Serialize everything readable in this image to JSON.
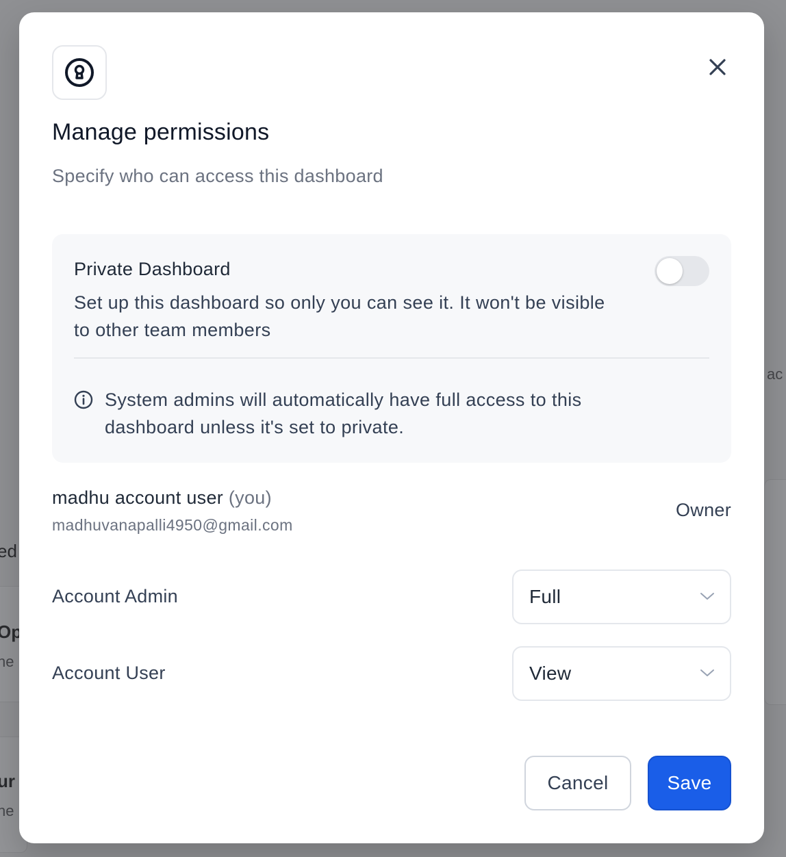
{
  "background": {
    "fragments": [
      "ed",
      "Op",
      "ne",
      "ur",
      "ne",
      "ac"
    ]
  },
  "modal": {
    "icon": "keyhole-lock-icon",
    "close_icon": "close-icon",
    "title": "Manage permissions",
    "subtitle": "Specify who can access this dashboard"
  },
  "private": {
    "title": "Private Dashboard",
    "description": "Set up this dashboard so only you can see it. It won't be visible to other team members",
    "enabled": false,
    "info_icon": "info-circle-icon",
    "info_text": "System admins will automatically have full access to this dashboard unless it's set to private."
  },
  "owner": {
    "name": "madhu account user",
    "you_tag": "(you)",
    "email": "madhuvanapalli4950@gmail.com",
    "role": "Owner"
  },
  "permissions": [
    {
      "label": "Account Admin",
      "value": "Full"
    },
    {
      "label": "Account User",
      "value": "View"
    }
  ],
  "actions": {
    "cancel_label": "Cancel",
    "save_label": "Save"
  },
  "colors": {
    "primary": "#1a5ee8",
    "overlay": "#8c8d90",
    "panel": "#f7f8fa"
  }
}
